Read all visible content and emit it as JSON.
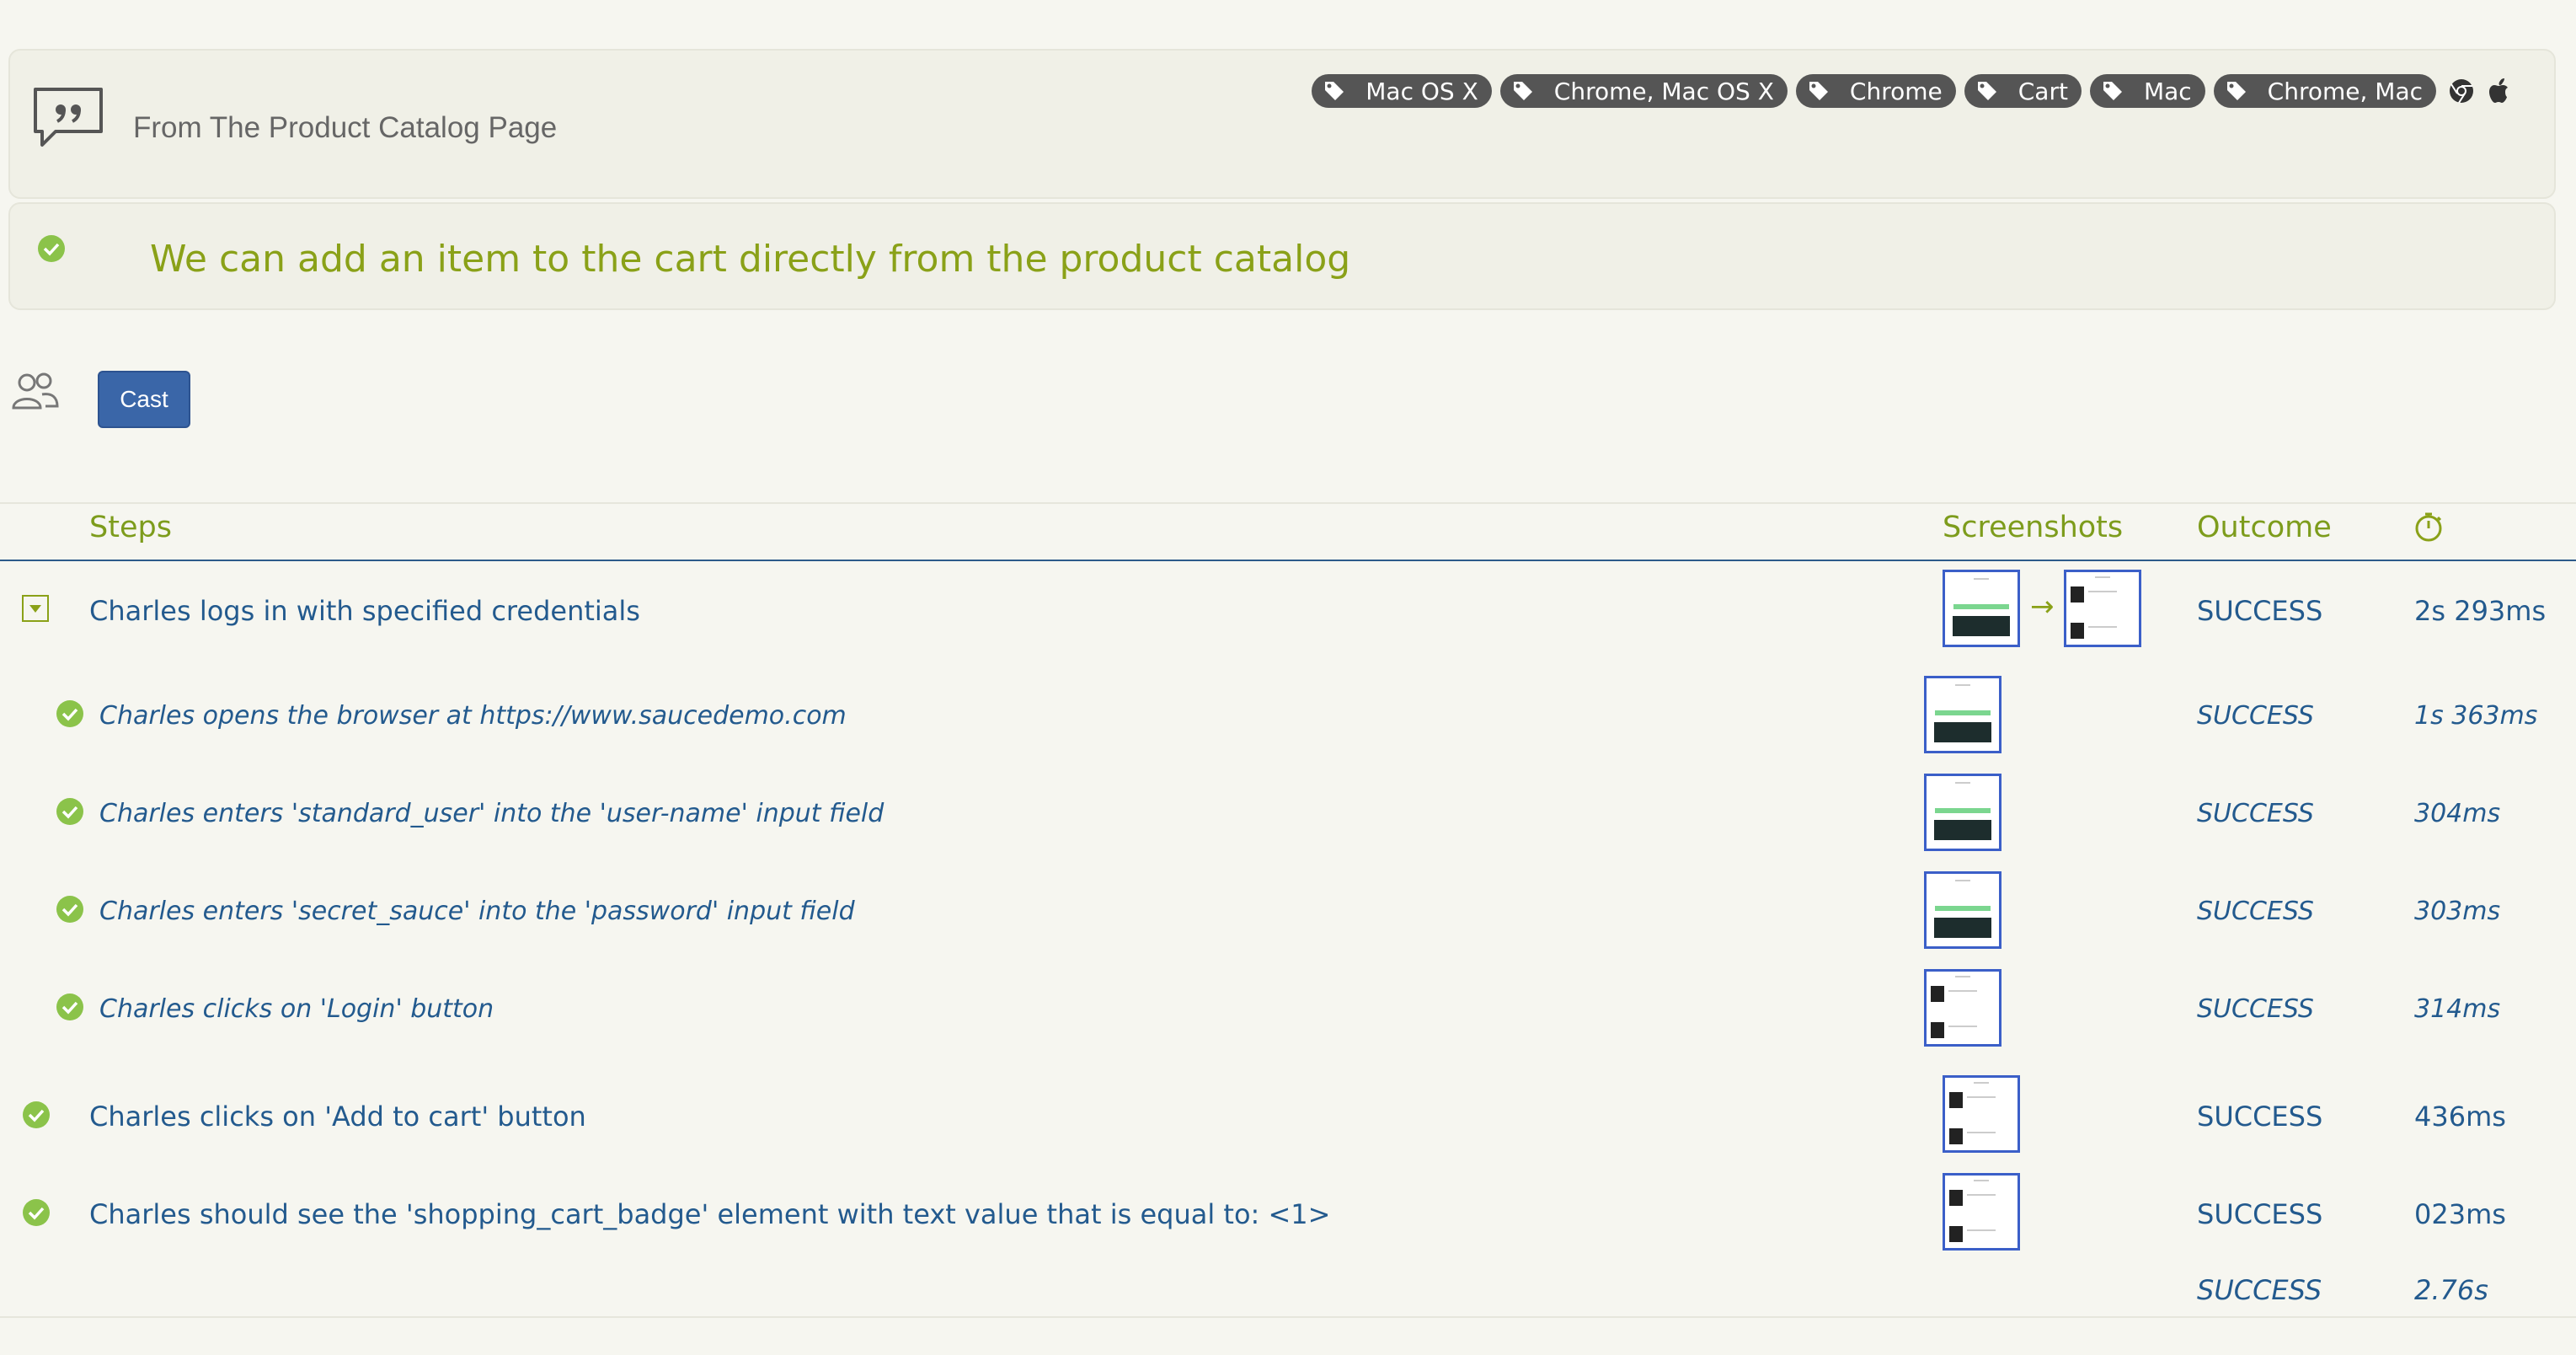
{
  "story": {
    "title": "From The Product Catalog Page",
    "tags": [
      "Mac OS X",
      "Chrome, Mac OS X",
      "Chrome",
      "Cart",
      "Mac",
      "Chrome, Mac"
    ]
  },
  "scenario": {
    "title": "We can add an item to the cart directly from the product catalog",
    "status_color": "#8bc34a"
  },
  "cast": {
    "button_label": "Cast"
  },
  "table": {
    "headers": {
      "steps": "Steps",
      "screenshots": "Screenshots",
      "outcome": "Outcome"
    },
    "rows": [
      {
        "text": "Charles logs in with specified credentials",
        "outcome": "SUCCESS",
        "duration": "2s 293ms"
      },
      {
        "text": "Charles opens the browser at https://www.saucedemo.com",
        "outcome": "SUCCESS",
        "duration": "1s 363ms"
      },
      {
        "text": "Charles enters 'standard_user' into the 'user-name' input field",
        "outcome": "SUCCESS",
        "duration": "304ms"
      },
      {
        "text": "Charles enters 'secret_sauce' into the 'password' input field",
        "outcome": "SUCCESS",
        "duration": "303ms"
      },
      {
        "text": "Charles clicks on 'Login' button",
        "outcome": "SUCCESS",
        "duration": "314ms"
      },
      {
        "text": "Charles clicks on 'Add to cart' button",
        "outcome": "SUCCESS",
        "duration": "436ms"
      },
      {
        "text": "Charles should see the 'shopping_cart_badge' element with text value that is equal to: <1>",
        "outcome": "SUCCESS",
        "duration": "023ms"
      }
    ],
    "total": {
      "outcome": "SUCCESS",
      "duration": "2.76s"
    }
  },
  "colors": {
    "accent_green": "#8aa118",
    "link_blue": "#235a8e",
    "cast_button": "#3a66a8"
  }
}
